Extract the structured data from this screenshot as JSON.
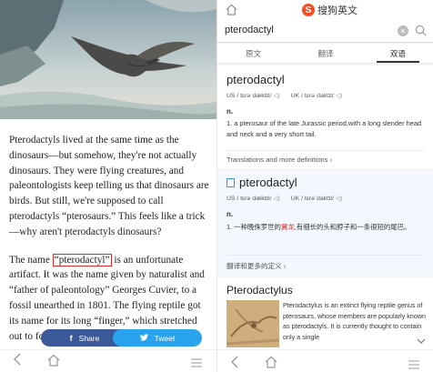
{
  "article": {
    "p1": "Pterodactyls lived at the same time as the dinosaurs—but somehow, they're not actually dinosaurs. They were flying creatures, and paleontologists keep telling us that dinosaurs are birds. But still, we're supposed to call pterodactyls “pterosaurs.” This feels like a trick—why aren't pterodactyls dinosaurs?",
    "p2_before": "The name ",
    "p2_highlight": "“pterodactyl”",
    "p2_after": " is an unfortunate artifact. It was the name given by naturalist and “father of paleontology” Georges Cuvier, to a fossil unearthed in 1801. The flying reptile got its name for its long “finger,” which stretched out to form a"
  },
  "share": {
    "facebook_label": "Share",
    "twitter_label": "Tweet"
  },
  "dict": {
    "logo_text": "搜狗英文",
    "logo_letter": "S",
    "search_value": "pterodactyl",
    "tabs": [
      "原文",
      "翻译",
      "双语"
    ],
    "active_tab": 2,
    "en": {
      "word": "pterodactyl",
      "us_pron": "US / tɛrəˈdæktɪl/",
      "uk_pron": "UK / tɛrəˈdaktɪl/",
      "pos": "n.",
      "def": "1.  a pterosaur of the late Jurassic period,with a long slender head and neck and a very short tail.",
      "more": "Translations and more definitions"
    },
    "cn": {
      "word": "pterodactyl",
      "us_pron": "US / tɛrəˈdæktɪl/",
      "uk_pron": "UK / tɛrəˈdaktɪl/",
      "pos": "n.",
      "def_before": "1.  一种晚侏罗世的",
      "def_red": "翼龙",
      "def_after": ",有细长的头和脖子和一条很短的尾巴。",
      "more": "翻译和更多的定义"
    },
    "wiki": {
      "title": "Pterodactylus",
      "text": "Pterodactylus is an extinct flying reptile genus of pterosaurs, whose members are popularly known as pterodactyls. It is currently thought to contain only a single"
    }
  },
  "colors": {
    "accent": "#f04e23",
    "highlight": "#e02a2a",
    "facebook": "#3b5998",
    "twitter": "#2aa3ef"
  }
}
